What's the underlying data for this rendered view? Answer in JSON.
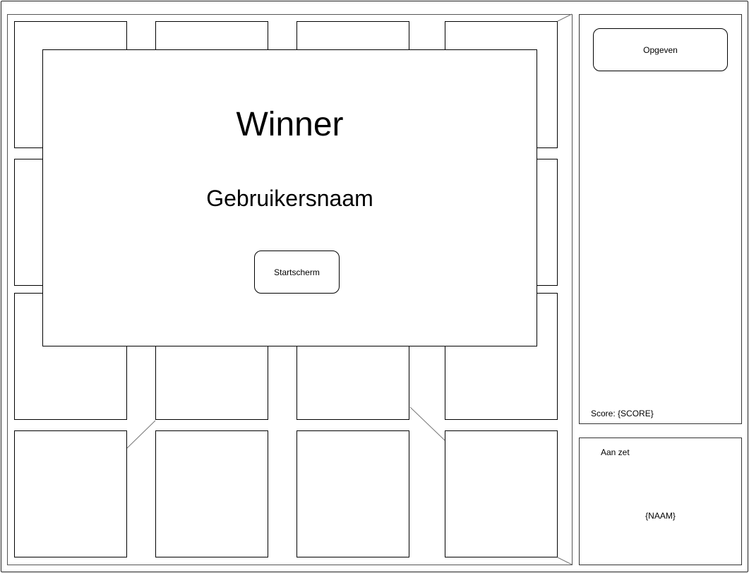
{
  "sidebar": {
    "quit_label": "Opgeven",
    "score_text": "Score: {SCORE}"
  },
  "turn_panel": {
    "label": "Aan zet",
    "name": "{NAAM}"
  },
  "winner_dialog": {
    "title": "Winner",
    "username": "Gebruikersnaam",
    "start_screen_label": "Startscherm"
  },
  "board": {
    "rows": 4,
    "cols": 4
  }
}
